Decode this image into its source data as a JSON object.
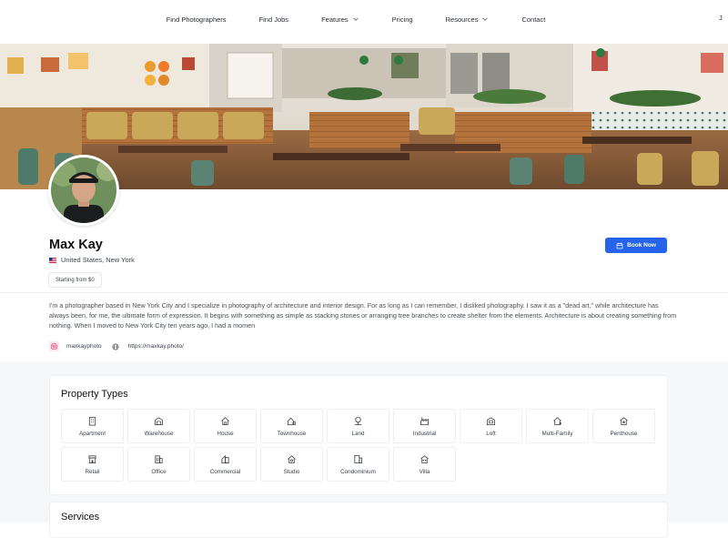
{
  "nav": {
    "items": [
      {
        "label": "Find Photographers",
        "has_dropdown": false
      },
      {
        "label": "Find Jobs",
        "has_dropdown": false
      },
      {
        "label": "Features",
        "has_dropdown": true
      },
      {
        "label": "Pricing",
        "has_dropdown": false
      },
      {
        "label": "Resources",
        "has_dropdown": true
      },
      {
        "label": "Contact",
        "has_dropdown": false
      }
    ],
    "user_initial": "J"
  },
  "profile": {
    "name": "Max Kay",
    "location": "United States, New York",
    "flag_icon": "us-flag-icon",
    "price_badge": "Starting from $0",
    "book_button": "Book Now",
    "book_icon": "calendar-icon",
    "bio": "I'm a photographer based in New York City and I specialize in photography of architecture and interior design. For as long as I can remember, I disliked photography. I saw it as a \"dead art,\" while architecture has always been, for me, the ultimate form of expression. It begins with something as simple as stacking stones or arranging tree branches to create shelter from the elements. Architecture is about creating something from nothing. When I moved to New York City ten years ago, I had a momen",
    "instagram": "maxkayphoto",
    "website": "https://maxkay.photo/"
  },
  "property_types": {
    "title": "Property Types",
    "items": [
      {
        "label": "Apartment",
        "icon": "apartment-icon"
      },
      {
        "label": "Warehouse",
        "icon": "warehouse-icon"
      },
      {
        "label": "House",
        "icon": "house-icon"
      },
      {
        "label": "Townhouse",
        "icon": "townhouse-icon"
      },
      {
        "label": "Land",
        "icon": "land-icon"
      },
      {
        "label": "Industrial",
        "icon": "industrial-icon"
      },
      {
        "label": "Loft",
        "icon": "loft-icon"
      },
      {
        "label": "Multi-Family",
        "icon": "multi-family-icon"
      },
      {
        "label": "Penthouse",
        "icon": "penthouse-icon"
      },
      {
        "label": "Retail",
        "icon": "retail-icon"
      },
      {
        "label": "Office",
        "icon": "office-icon"
      },
      {
        "label": "Commercial",
        "icon": "commercial-icon"
      },
      {
        "label": "Studio",
        "icon": "studio-icon"
      },
      {
        "label": "Condominium",
        "icon": "condominium-icon"
      },
      {
        "label": "Villa",
        "icon": "villa-icon"
      }
    ]
  },
  "services": {
    "title": "Services"
  },
  "colors": {
    "accent": "#2563eb",
    "page_bg": "#f6f7f9"
  }
}
